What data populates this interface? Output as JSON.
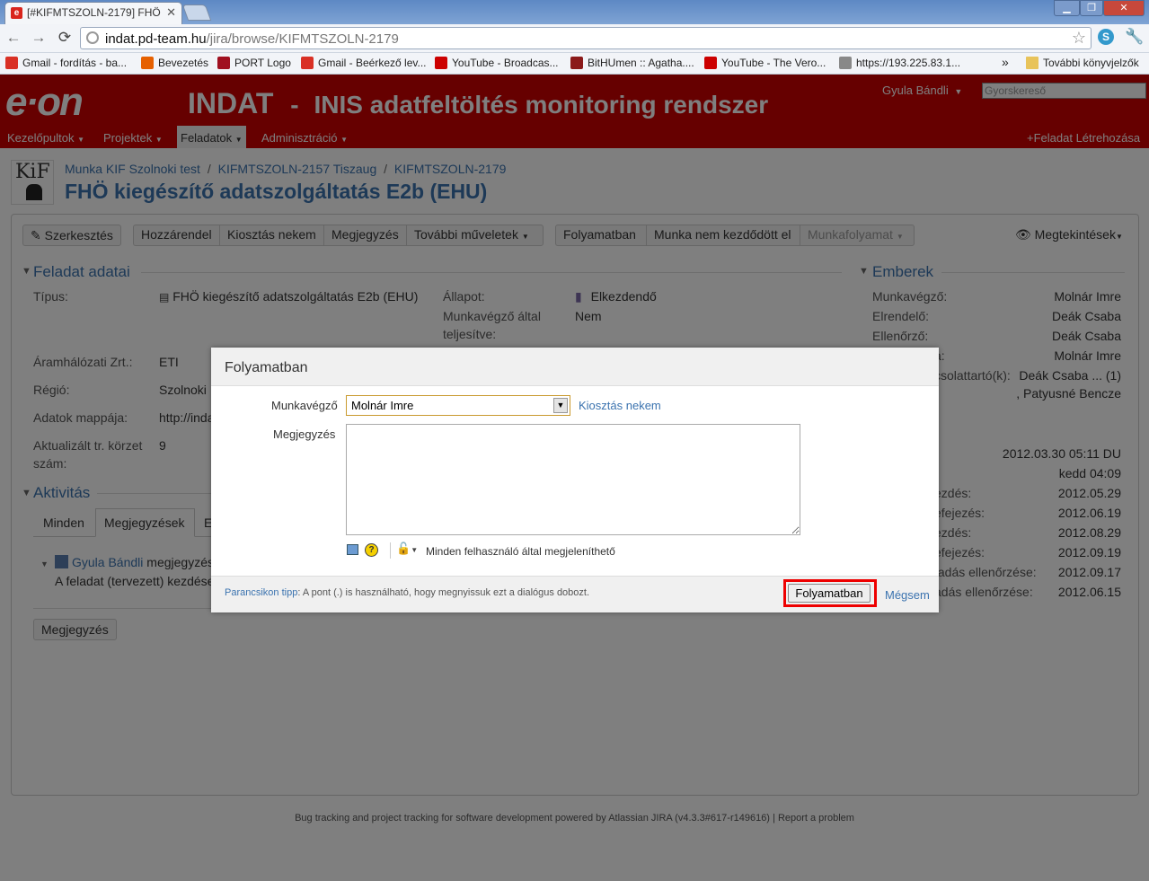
{
  "browser": {
    "tab_title": "[#KIFMTSZOLN-2179] FHÖ",
    "url_host": "indat.pd-team.hu",
    "url_path": "/jira/browse/KIFMTSZOLN-2179",
    "bookmarks": [
      {
        "label": "Gmail - fordítás - ba...",
        "icon": "gmail-icon",
        "color": "#d93025"
      },
      {
        "label": "Bevezetés",
        "icon": "firefox-icon",
        "color": "#e66000"
      },
      {
        "label": "PORT Logo",
        "icon": "port-icon",
        "color": "#a01020"
      },
      {
        "label": "Gmail - Beérkező lev...",
        "icon": "gmail-icon",
        "color": "#d93025"
      },
      {
        "label": "YouTube - Broadcas...",
        "icon": "youtube-icon",
        "color": "#cc0000"
      },
      {
        "label": "BitHUmen :: Agatha....",
        "icon": "bithumen-icon",
        "color": "#8b1a1a"
      },
      {
        "label": "YouTube - The Vero...",
        "icon": "youtube-icon",
        "color": "#cc0000"
      },
      {
        "label": "https://193.225.83.1...",
        "icon": "globe-icon",
        "color": "#888888"
      }
    ],
    "other_bookmarks": "További könyvjelzők",
    "overflow": "»"
  },
  "header": {
    "logo": "e·on",
    "app_title": "INDAT",
    "app_dash": "-",
    "app_subtitle": "INIS adatfeltöltés monitoring rendszer",
    "user": "Gyula Bándli",
    "quicksearch_placeholder": "Gyorskereső",
    "menu": [
      "Kezelőpultok",
      "Projektek",
      "Feladatok",
      "Adminisztráció"
    ],
    "create": "Feladat Létrehozása",
    "brand_color": "#cc0000"
  },
  "issue": {
    "avatar_text": "KiF",
    "breadcrumb": [
      "Munka KIF Szolnoki test",
      "KIFMTSZOLN-2157 Tiszaug",
      "KIFMTSZOLN-2179"
    ],
    "sep": "/",
    "title": "FHÖ kiegészítő adatszolgáltatás E2b (EHU)",
    "buttons": {
      "edit": "Szerkesztés",
      "assign": "Hozzárendel",
      "assign_me": "Kiosztás nekem",
      "comment": "Megjegyzés",
      "more": "További műveletek",
      "inprogress": "Folyamatban",
      "notstarted": "Munka nem kezdődött el",
      "workflow": "Munkafolyamat",
      "views": "Megtekintések"
    },
    "details_title": "Feladat adatai",
    "details": {
      "type_label": "Típus:",
      "type_value": "FHÖ kiegészítő adatszolgáltatás E2b (EHU)",
      "status_label": "Állapot:",
      "status_value": "Elkezdendő",
      "done_label_1": "Munkavégző által",
      "done_label_2": "teljesítve:",
      "done_value": "Nem",
      "zrt_label": "Áramhálózati Zrt.:",
      "zrt_value": "ETI",
      "region_label": "Régió:",
      "region_value": "Szolnoki",
      "folder_label": "Adatok mappája:",
      "folder_value": "http://inda",
      "district_label_1": "Aktualizált tr. körzet",
      "district_label_2": "szám:",
      "district_value": "9"
    },
    "activity_title": "Aktivitás",
    "activity_tabs": [
      "Minden",
      "Megjegyzések",
      "E"
    ],
    "activity_user": "Gyula Bándli",
    "activity_action": "megjegyzés",
    "activity_text": "A feladat (tervezett) kezdése",
    "comment_button": "Megjegyzés",
    "people_title": "Emberek",
    "people": [
      {
        "label": "Munkavégző:",
        "value": "Molnár Imre"
      },
      {
        "label": "Elrendelő:",
        "value": "Deák Csaba"
      },
      {
        "label": "Ellenőrző:",
        "value": "Deák Csaba"
      },
      {
        "label": "a:",
        "value": "Molnár Imre"
      },
      {
        "label": "csolattartó(k):",
        "value": "Deák Csaba ... (1)"
      },
      {
        "label": "",
        "value": ", Patyusné Bencze"
      }
    ],
    "dates": [
      {
        "label": "",
        "value": "2012.03.30 05:11 DU"
      },
      {
        "label": "",
        "value": "kedd 04:09"
      },
      {
        "label": "ezdés:",
        "value": "2012.05.29"
      },
      {
        "label": "efejezés:",
        "value": "2012.06.19"
      },
      {
        "label": "ezdés:",
        "value": "2012.08.29"
      },
      {
        "label": "efejezés:",
        "value": "2012.09.19"
      },
      {
        "label": "tadás ellenőrzése:",
        "value": "2012.09.17"
      },
      {
        "label": "adás ellenőrzése:",
        "value": "2012.06.15"
      }
    ]
  },
  "footer": "Bug tracking and project tracking for software development powered by Atlassian JIRA (v4.3.3#617-r149616) | Report a problem",
  "dialog": {
    "title": "Folyamatban",
    "assignee_label": "Munkavégző",
    "assignee_value": "Molnár Imre",
    "assign_to_me": "Kiosztás nekem",
    "comment_label": "Megjegyzés",
    "visibility": "Minden felhasználó által megjeleníthető",
    "tip_label": "Parancsikon tipp",
    "tip_text": ": A pont (.) is használható, hogy megnyissuk ezt a dialógus dobozt.",
    "submit": "Folyamatban",
    "cancel": "Mégsem"
  }
}
